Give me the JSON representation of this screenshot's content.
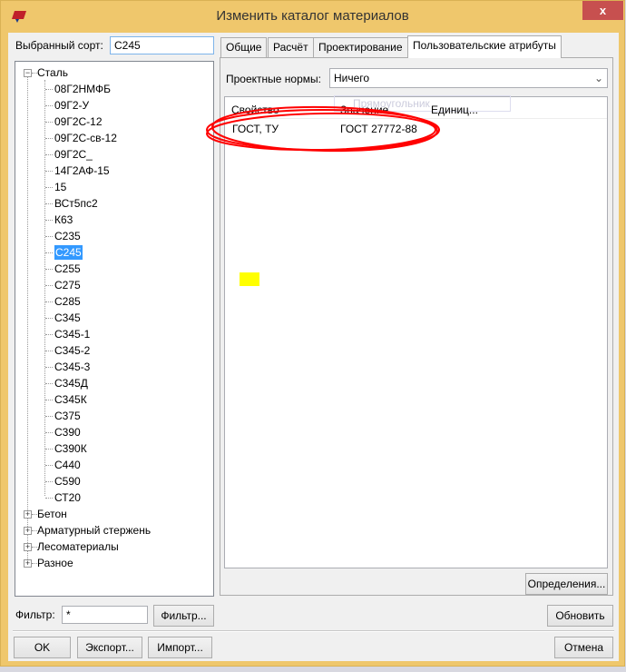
{
  "window": {
    "title": "Изменить каталог материалов",
    "close_label": "x"
  },
  "left": {
    "selected_label": "Выбранный сорт:",
    "selected_value": "C245",
    "tree": {
      "root": "Сталь",
      "children": [
        "08Г2НМФБ",
        "09Г2-У",
        "09Г2С-12",
        "09Г2С-св-12",
        "09Г2С_",
        "14Г2АФ-15",
        "15",
        "ВСт5пс2",
        "К63",
        "С235",
        "С245",
        "С255",
        "С275",
        "С285",
        "С345",
        "С345-1",
        "С345-2",
        "С345-3",
        "С345Д",
        "С345К",
        "С375",
        "С390",
        "С390К",
        "С440",
        "С590",
        "СТ20"
      ],
      "selected": "С245",
      "others": [
        "Бетон",
        "Арматурный стержень",
        "Лесоматериалы",
        "Разное"
      ]
    },
    "filter_label": "Фильтр:",
    "filter_value": "*",
    "filter_button": "Фильтр..."
  },
  "tabs": [
    "Общие",
    "Расчёт",
    "Проектирование",
    "Пользовательские атрибуты"
  ],
  "active_tab": "Пользовательские атрибуты",
  "attributes": {
    "norms_label": "Проектные нормы:",
    "norms_value": "Ничего",
    "columns": [
      "Свойство",
      "Значение",
      "Единиц..."
    ],
    "rows": [
      {
        "property": "ГОСТ, ТУ",
        "value": "ГОСТ 27772-88",
        "unit": ""
      }
    ],
    "tooltip": "Прямоугольник",
    "definitions_button": "Определения..."
  },
  "buttons": {
    "refresh": "Обновить",
    "ok": "OK",
    "export": "Экспорт...",
    "import": "Импорт...",
    "cancel": "Отмена"
  },
  "colors": {
    "frame": "#efc76c",
    "selection": "#3399ff",
    "annotation": "#ff0000",
    "highlight": "#ffff00"
  }
}
